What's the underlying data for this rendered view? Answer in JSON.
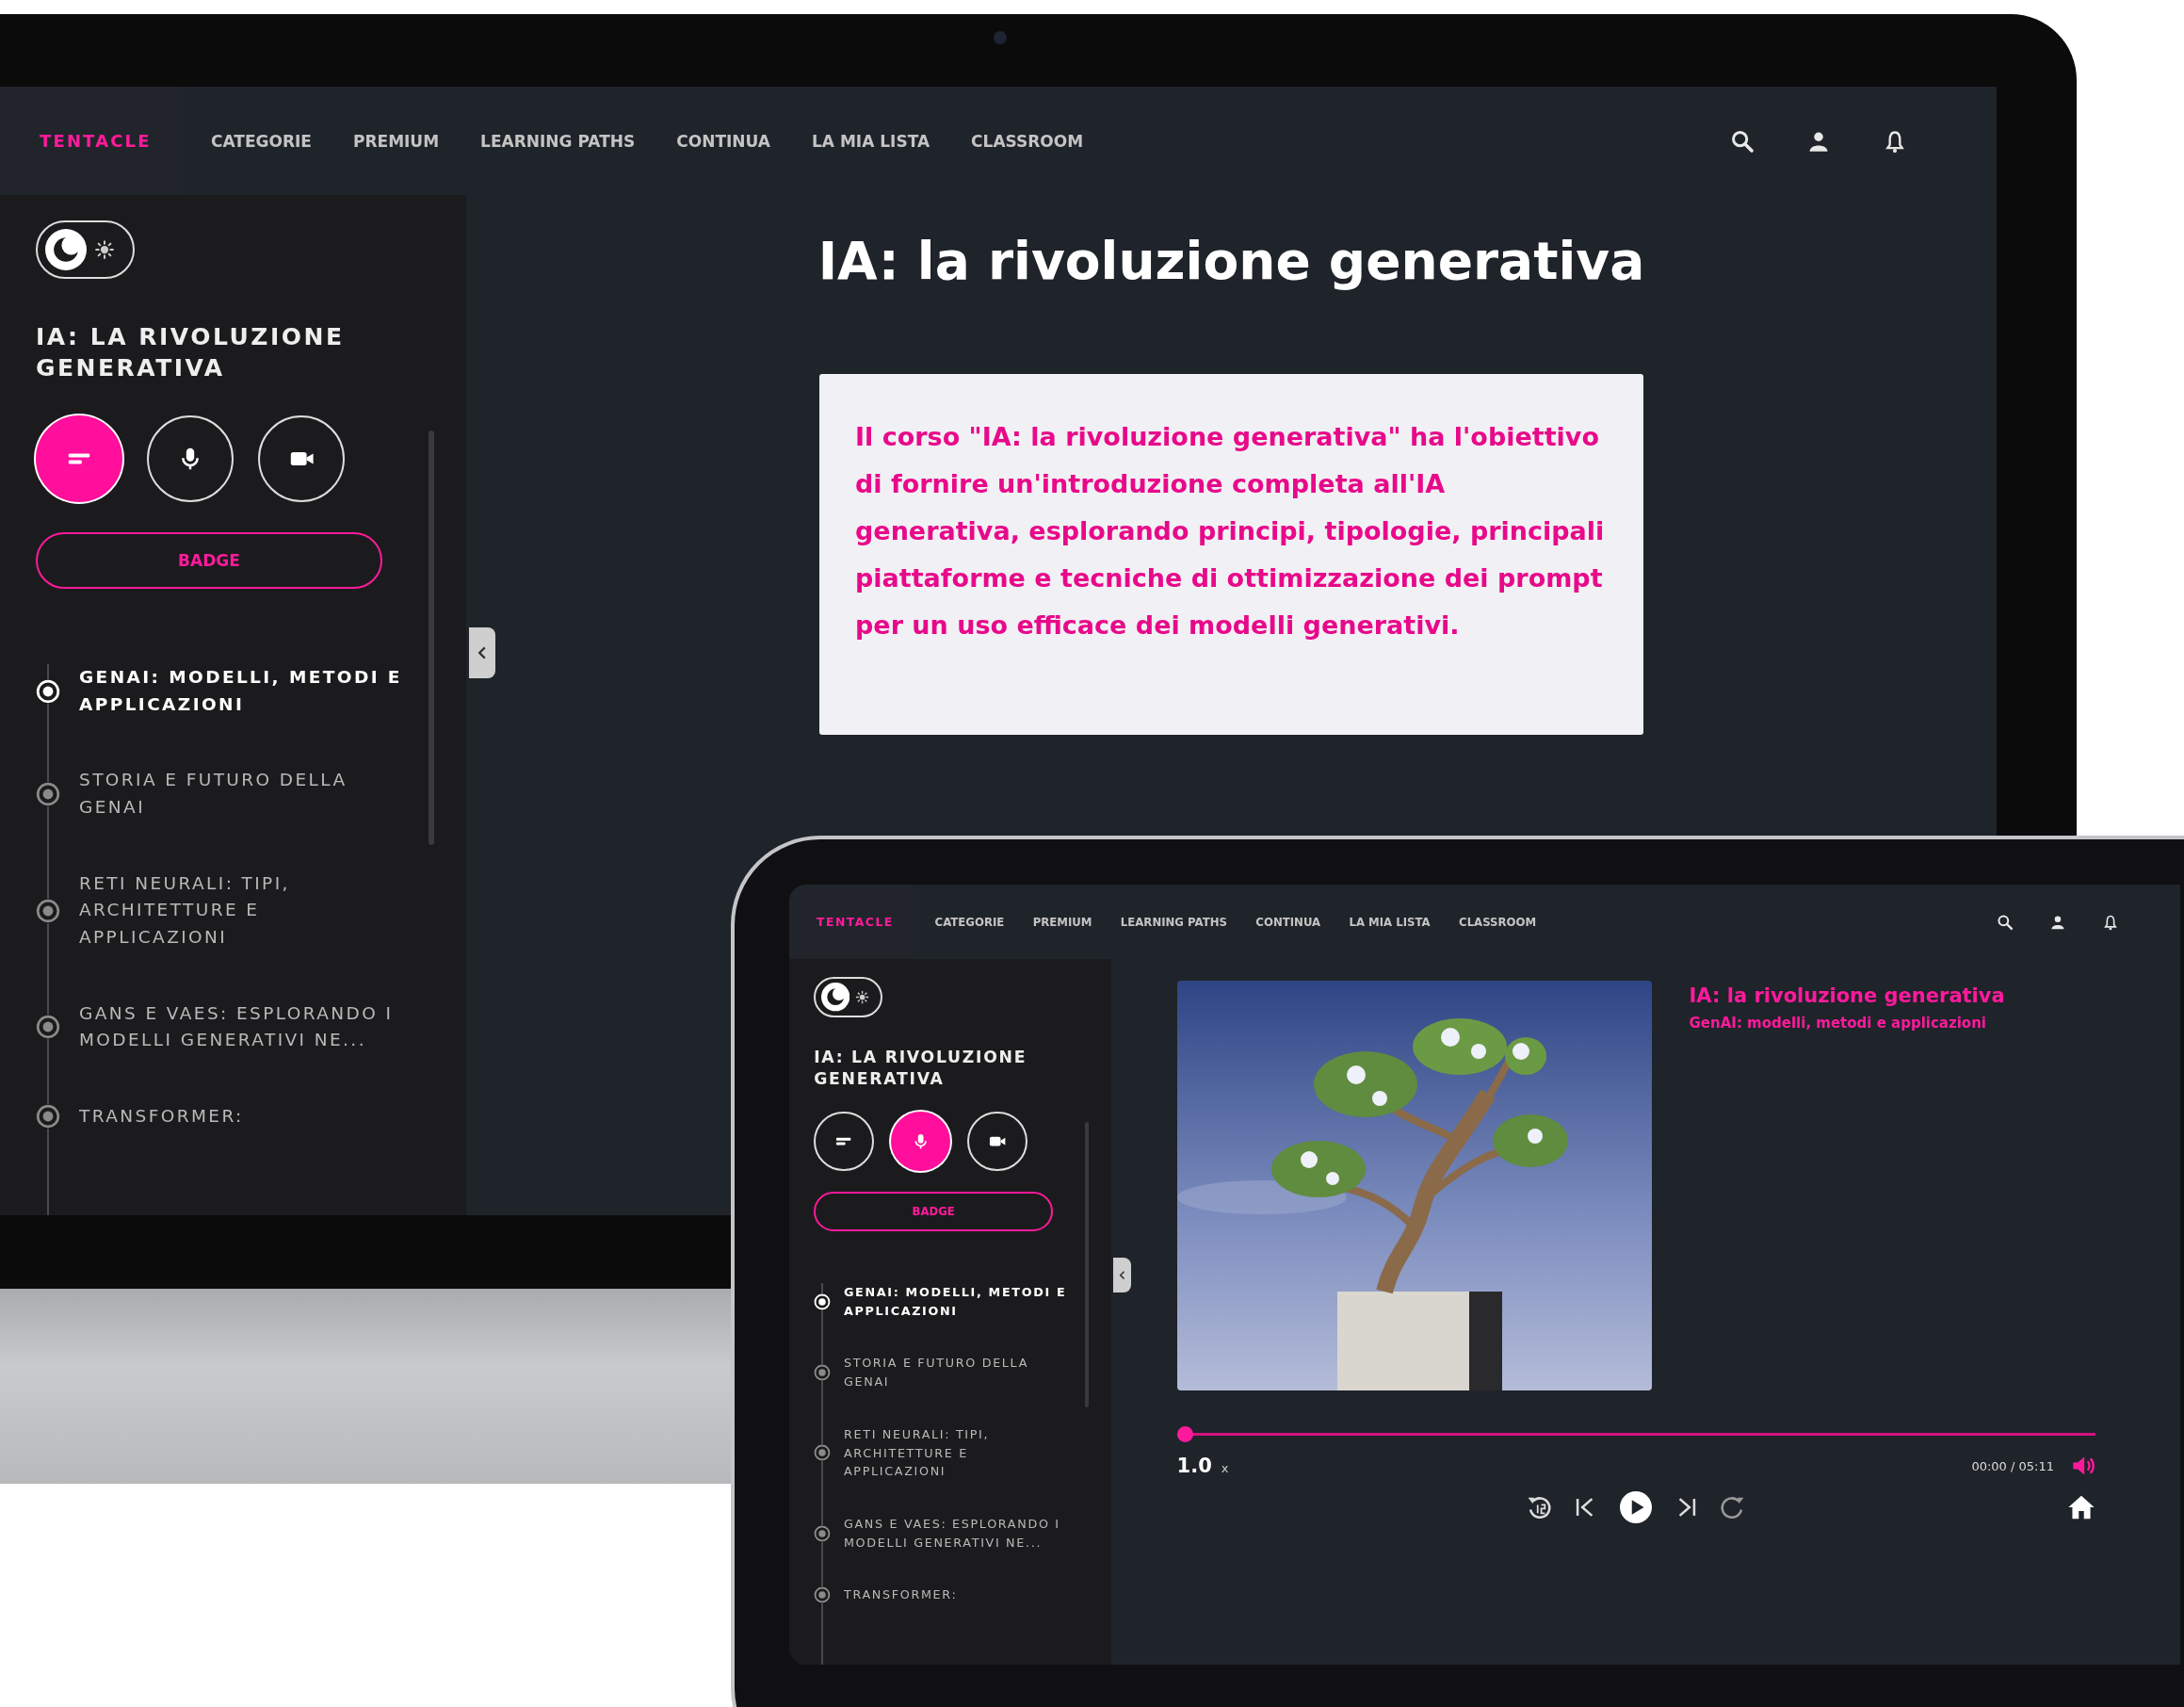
{
  "monitor": {
    "screen": {
      "nav": {
        "logo": "TENTACLE",
        "items": [
          "CATEGORIE",
          "PREMIUM",
          "LEARNING PATHS",
          "CONTINUA",
          "LA MIA LISTA",
          "CLASSROOM"
        ]
      },
      "sidebar": {
        "theme_toggle": {
          "dark": true
        },
        "course_title": "IA: LA RIVOLUZIONE GENERATIVA",
        "modes": [
          {
            "kind": "text",
            "selected": true
          },
          {
            "kind": "audio",
            "selected": false
          },
          {
            "kind": "video",
            "selected": false
          }
        ],
        "badge_button": "BADGE",
        "chapters": [
          {
            "title": "GENAI: MODELLI, METODI E APPLICAZIONI",
            "selected": true
          },
          {
            "title": "STORIA E FUTURO DELLA GENAI",
            "selected": false
          },
          {
            "title": "RETI NEURALI: TIPI, ARCHITETTURE E APPLICAZIONI",
            "selected": false
          },
          {
            "title": "GANS E VAES: ESPLORANDO I MODELLI GENERATIVI NE...",
            "selected": false
          },
          {
            "title": "TRANSFORMER:",
            "selected": false
          }
        ]
      },
      "main": {
        "kind": "course_intro",
        "title": "IA: la rivoluzione generativa",
        "description": "Il corso \"IA: la rivoluzione generativa\" ha l'obiettivo di fornire un'introduzione completa all'IA generativa, esplorando principi, tipologie, principali piattaforme e tecniche di ottimizzazione dei prompt per un uso efficace dei modelli generativi."
      }
    }
  },
  "tablet": {
    "screen": {
      "nav": {
        "logo": "TENTACLE",
        "items": [
          "CATEGORIE",
          "PREMIUM",
          "LEARNING PATHS",
          "CONTINUA",
          "LA MIA LISTA",
          "CLASSROOM"
        ]
      },
      "sidebar": {
        "theme_toggle": {
          "dark": true
        },
        "course_title": "IA: LA RIVOLUZIONE GENERATIVA",
        "modes": [
          {
            "kind": "text",
            "selected": false
          },
          {
            "kind": "audio",
            "selected": true
          },
          {
            "kind": "video",
            "selected": false
          }
        ],
        "badge_button": "BADGE",
        "chapters": [
          {
            "title": "GENAI: MODELLI, METODI E APPLICAZIONI",
            "selected": true
          },
          {
            "title": "STORIA E FUTURO DELLA GENAI",
            "selected": false
          },
          {
            "title": "RETI NEURALI: TIPI, ARCHITETTURE E APPLICAZIONI",
            "selected": false
          },
          {
            "title": "GANS E VAES: ESPLORANDO I MODELLI GENERATIVI NE...",
            "selected": false
          },
          {
            "title": "TRANSFORMER:",
            "selected": false
          }
        ]
      },
      "main": {
        "kind": "player",
        "title": "IA: la rivoluzione generativa",
        "subtitle": "GenAI: modelli, metodi e applicazioni",
        "progress": {
          "level": 0
        },
        "speed": "1.0",
        "speed_unit": "x",
        "time": "00:00 / 05:11"
      }
    }
  }
}
